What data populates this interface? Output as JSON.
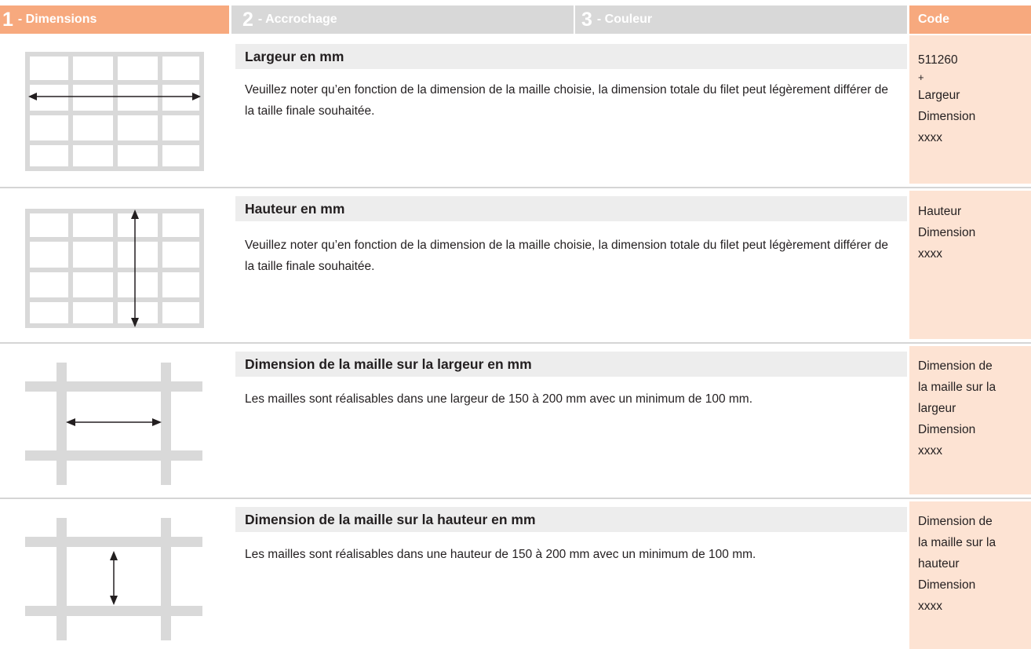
{
  "tabs": [
    {
      "num": "1",
      "label": "- Dimensions"
    },
    {
      "num": "2",
      "label": "- Accrochage"
    },
    {
      "num": "3",
      "label": "- Couleur"
    },
    {
      "num": "",
      "label": "Code"
    }
  ],
  "rows": [
    {
      "title": "Largeur en mm",
      "description": "Veuillez noter qu’en fonction de la dimension de la maille choisie, la dimension totale du filet peut légèrement différer de la taille finale souhaitée.",
      "code_lines": [
        "511260",
        "+",
        "Largeur",
        "Dimension",
        "xxxx"
      ],
      "illustration": "grid-width-arrow-icon"
    },
    {
      "title": "Hauteur en mm",
      "description": "Veuillez noter qu’en fonction de la dimension de la maille choisie, la dimension totale du filet peut légèrement différer de la taille finale souhaitée.",
      "code_lines": [
        "Hauteur",
        "Dimension",
        "xxxx"
      ],
      "illustration": "grid-height-arrow-icon"
    },
    {
      "title": "Dimension de la maille sur la largeur en mm",
      "description": "Les mailles sont réalisables dans une largeur de 150 à 200 mm avec un minimum de 100 mm.",
      "code_lines": [
        "Dimension de",
        "la maille sur la",
        "largeur",
        "Dimension",
        "xxxx"
      ],
      "illustration": "mesh-width-arrow-icon"
    },
    {
      "title": "Dimension de la maille sur la hauteur en mm",
      "description": "Les mailles sont réalisables dans une hauteur de 150 à 200 mm avec un minimum de 100 mm.",
      "code_lines": [
        "Dimension de",
        "la maille sur la",
        "hauteur",
        "Dimension",
        "xxxx"
      ],
      "illustration": "mesh-height-arrow-icon"
    }
  ],
  "colors": {
    "accent": "#f7a97e",
    "code_background": "#fde3d3",
    "inactive_tab": "#d8d8d8",
    "title_bar": "#ededed",
    "grid": "#d9d9d9"
  }
}
